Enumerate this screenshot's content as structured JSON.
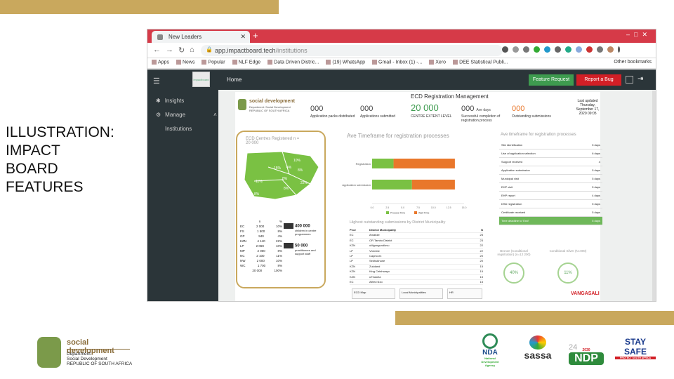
{
  "slide": {
    "title": "ILLUSTRATION:\nIMPACT\nBOARD\nFEATURES",
    "page_number": "24"
  },
  "browser": {
    "tab_title": "New Leaders",
    "url_domain": "app.impactboard.tech",
    "url_path": "/institutions",
    "bookmarks": [
      "Apps",
      "News",
      "Popular",
      "NLF Edge",
      "Data Driven Distric...",
      "(19) WhatsApp",
      "Gmail - Inbox (1) -...",
      "Xero",
      "DEE Statistical Publi..."
    ],
    "other_bookmarks": "Other bookmarks"
  },
  "app": {
    "sidebar": {
      "items": [
        {
          "label": "Insights",
          "icon": "bulb-icon"
        },
        {
          "label": "Manage",
          "icon": "gear-icon"
        }
      ],
      "sub_item": "Institutions"
    },
    "topnav": {
      "home": "Home",
      "feature_request": "Feature Request",
      "report_bug": "Report a Bug",
      "logo_text": "impactboard"
    },
    "dashboard": {
      "title": "ECD Registration Management",
      "dept_name": "social development",
      "dept_sub": "Department: Social Development REPUBLIC OF SOUTH AFRICA",
      "kpis": [
        {
          "value": "000",
          "label": "Application packs distributed"
        },
        {
          "value": "000",
          "label": "Applications submitted"
        },
        {
          "value": "20 000",
          "label": "CENTRE EXTENT LEVEL"
        },
        {
          "value": "000",
          "unit": "Ave days",
          "label": "Successful completion of registration process"
        },
        {
          "value": "000",
          "label": "Outstanding submissions"
        }
      ],
      "last_updated": "Last updated Thursday, September 17, 2020 09:05",
      "map_card": {
        "title": "ECD Centres Registered n = 20 000",
        "percents": [
          "10%",
          "15%",
          "4%",
          "8%",
          "8%",
          "11%",
          "22%",
          "8%",
          "8%"
        ],
        "table_header": [
          "",
          "n",
          "%"
        ],
        "rows": [
          [
            "EC",
            "2 000",
            "10%"
          ],
          [
            "FS",
            "1 500",
            "8%"
          ],
          [
            "GP",
            "940",
            "4%"
          ],
          [
            "KZN",
            "4 140",
            "22%"
          ],
          [
            "LP",
            "2 069",
            "10%"
          ],
          [
            "MP",
            "2 000",
            "8%"
          ],
          [
            "NC",
            "2 100",
            "11%"
          ],
          [
            "NW",
            "2 000",
            "10%"
          ],
          [
            "WC",
            "1 700",
            "8%"
          ],
          [
            "",
            "20 000",
            "100%"
          ]
        ],
        "stat1_value": "400 000",
        "stat1_label": "children in centre programmes",
        "stat2_value": "50 000",
        "stat2_label": "practitioners and support staff"
      },
      "timeframe_title": "Ave Timeframe for registration processes",
      "rows_labels": [
        "Registration",
        "Application submission"
      ],
      "legend": [
        "Process Time",
        "Wait Time"
      ],
      "x_ticks": [
        "0.0",
        "2.5",
        "5.0",
        "7.5",
        "10.0",
        "12.5",
        "15.0"
      ],
      "table_title": "Highest outstanding submissions by District Municipality",
      "table_header": [
        "Prov",
        "District Municipality",
        "N"
      ],
      "table_rows": [
        [
          "EC",
          "Amatole",
          "25"
        ],
        [
          "EC",
          "OR Tambo District",
          "23"
        ],
        [
          "KZN",
          "uMgungundlovu",
          "22"
        ],
        [
          "LP",
          "Vhembe",
          "22"
        ],
        [
          "LP",
          "Capricorn",
          "20"
        ],
        [
          "LP",
          "Sekhukhune",
          "20"
        ],
        [
          "KZN",
          "Zululand",
          "15"
        ],
        [
          "KZN",
          "King Cetshwayo",
          "15"
        ],
        [
          "KZN",
          "uThukela",
          "15"
        ],
        [
          "EC",
          "Alfred Nzo",
          "15"
        ]
      ],
      "process_title": "Ave timeframe for registration processes",
      "process_rows": [
        [
          "Site identification",
          "5 days"
        ],
        [
          "Use of application selection",
          "6 days"
        ],
        [
          "Support received",
          "4"
        ],
        [
          "Application submission",
          "5 days"
        ],
        [
          "Municipal visit",
          "5 days"
        ],
        [
          "EHP visit",
          "5 days"
        ],
        [
          "EHP report",
          "4 days"
        ],
        [
          "DSD registration",
          "5 days"
        ],
        [
          "Certificate received",
          "5 days"
        ],
        [
          "Time deadline to 'End'",
          "5 days"
        ]
      ],
      "circle1_title": "Bronze (Conditional registration) (n=12 200)",
      "circle1_value": "40%",
      "circle2_title": "Conditional Silver (N=000)",
      "circle2_value": "11%",
      "footer_boxes": [
        "ECD Map",
        "Local Municipalities",
        "HR"
      ],
      "footer_brand": "VANGASALI"
    }
  },
  "footer": {
    "org": "social development",
    "l1": "Department:",
    "l2": "Social Development",
    "l3": "REPUBLIC OF SOUTH AFRICA",
    "partners": [
      "NDA",
      "sassa",
      "NDP",
      "STAY SAFE"
    ],
    "partner_subs": [
      "National Development Agency",
      "",
      "2030",
      "PROTECT SOUTH AFRICA"
    ]
  },
  "chart_data": {
    "type": "bar",
    "orientation": "horizontal",
    "stacked": true,
    "title": "Ave Timeframe for registration processes",
    "categories": [
      "Registration",
      "Application submission"
    ],
    "series": [
      {
        "name": "Process Time",
        "values": [
          3.5,
          6.5
        ]
      },
      {
        "name": "Wait Time",
        "values": [
          10,
          7
        ]
      }
    ],
    "xlim": [
      0,
      15
    ],
    "colors": [
      "#7ac143",
      "#e9772b"
    ],
    "legend": "bottom"
  }
}
